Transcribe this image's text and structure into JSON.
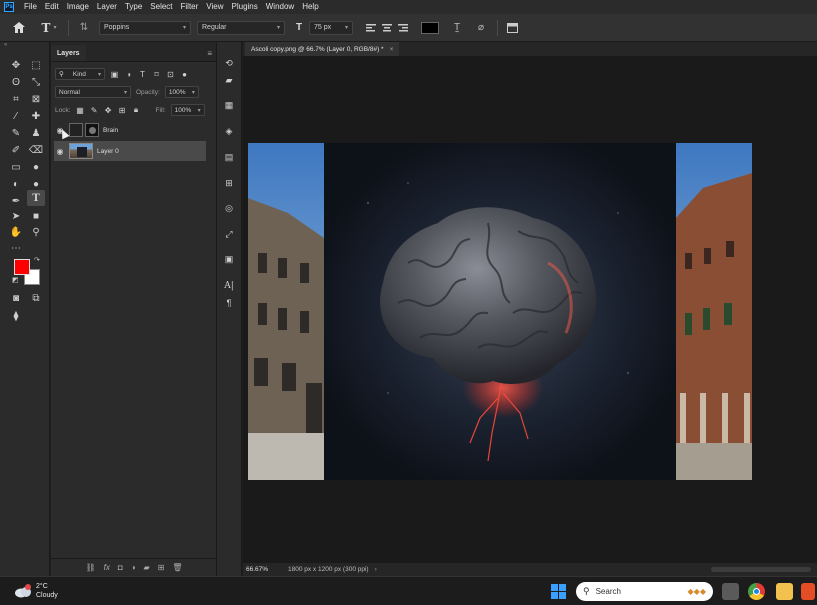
{
  "menu": [
    "File",
    "Edit",
    "Image",
    "Layer",
    "Type",
    "Select",
    "Filter",
    "View",
    "Plugins",
    "Window",
    "Help"
  ],
  "app_logo_text": "Ps",
  "options": {
    "font_family": "Poppins",
    "font_style": "Regular",
    "font_size": "75 px",
    "text_color": "#000000"
  },
  "layers_panel": {
    "tab": "Layers",
    "filter_kind": "Kind",
    "blend_mode": "Normal",
    "opacity_label": "Opacity:",
    "opacity_value": "100%",
    "lock_label": "Lock:",
    "fill_label": "Fill:",
    "fill_value": "100%",
    "layers": [
      {
        "name": "Brain",
        "selected": false
      },
      {
        "name": "Layer 0",
        "selected": true
      }
    ]
  },
  "document": {
    "tab_title": "Ascoli copy.png @ 66.7% (Layer 0, RGB/8#) *",
    "close": "×",
    "zoom": "66.67%",
    "doc_info": "1800 px x 1200 px (300 ppi)"
  },
  "colors": {
    "foreground": "#ff0000",
    "background": "#ffffff",
    "accent": "#31a8ff"
  },
  "taskbar": {
    "temperature": "2°C",
    "weather": "Cloudy",
    "search_placeholder": "Search"
  }
}
